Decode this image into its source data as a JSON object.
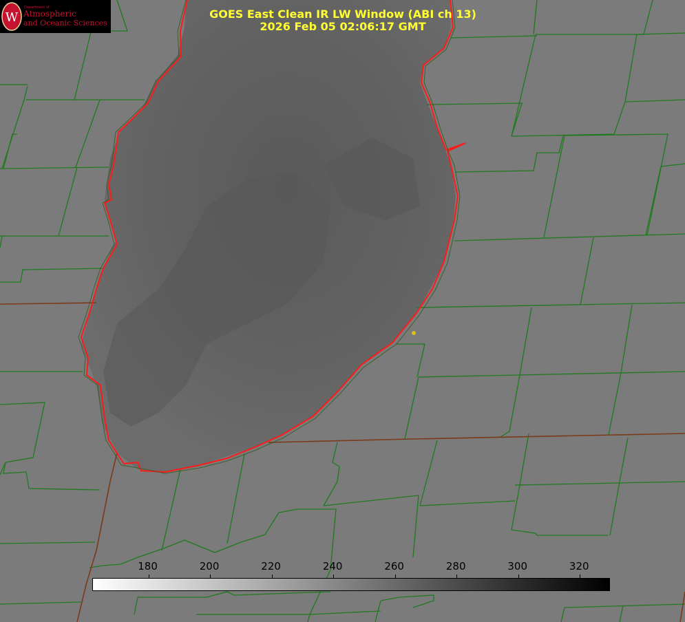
{
  "title": {
    "line1": "GOES East Clean IR LW Window (ABI ch 13)",
    "line2": "2026 Feb 05 02:06:17 GMT"
  },
  "logo": {
    "department": "Department of",
    "line1": "Atmospheric",
    "line2": "and Oceanic Sciences",
    "seal_letter": "W",
    "seal_color": "#c4122f"
  },
  "colorbar": {
    "ticks": [
      "180",
      "200",
      "220",
      "240",
      "260",
      "280",
      "300",
      "320"
    ],
    "min_value": 162,
    "max_value": 330,
    "gradient_start": "#ffffff",
    "gradient_end": "#000000"
  },
  "colors": {
    "land": "#7b7b7b",
    "lake": "#5f5f5f",
    "county_lines": "#1f7a1f",
    "state_lines": "#7a3a1a",
    "lake_outline": "#ff1a1a",
    "title": "#ffff33",
    "marker": "#d4c21a"
  }
}
